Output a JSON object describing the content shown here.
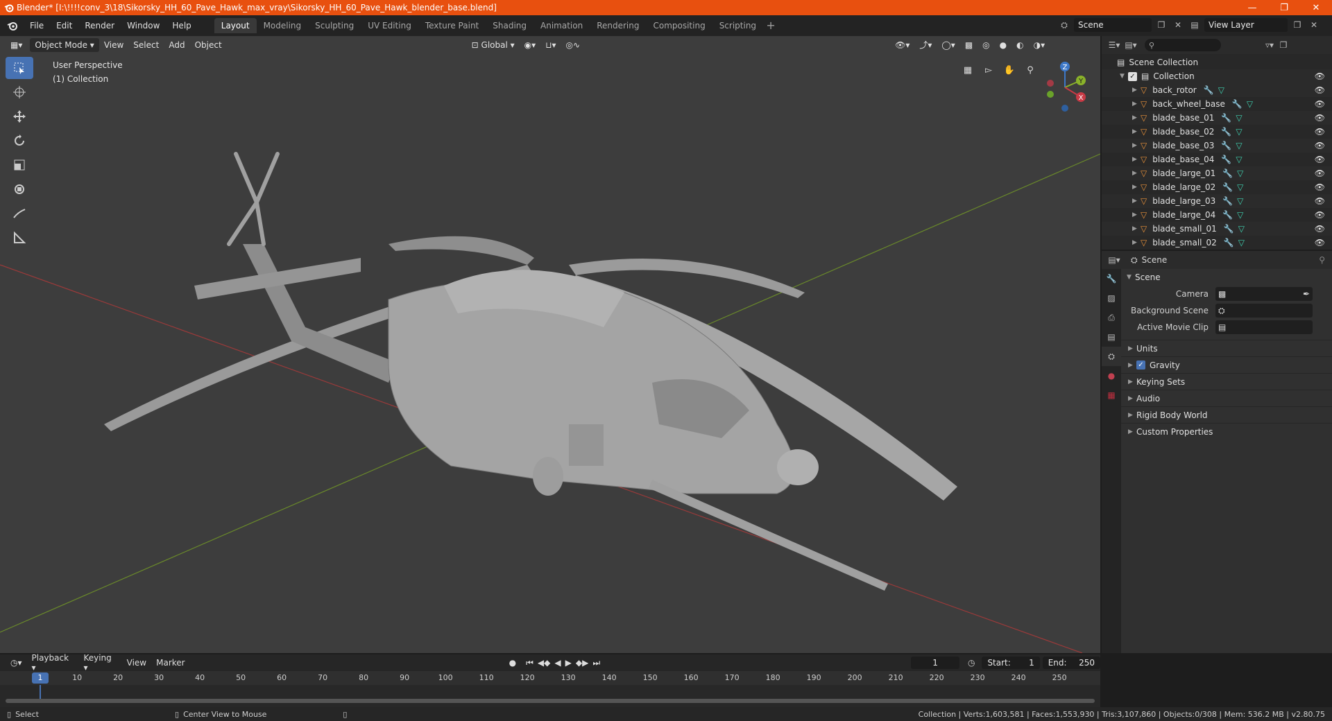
{
  "titlebar": {
    "title": "Blender* [I:\\!!!!conv_3\\18\\Sikorsky_HH_60_Pave_Hawk_max_vray\\Sikorsky_HH_60_Pave_Hawk_blender_base.blend]",
    "accent": "#e8500f"
  },
  "menu": {
    "file": "File",
    "edit": "Edit",
    "render": "Render",
    "window": "Window",
    "help": "Help"
  },
  "workspaces": [
    "Layout",
    "Modeling",
    "Sculpting",
    "UV Editing",
    "Texture Paint",
    "Shading",
    "Animation",
    "Rendering",
    "Compositing",
    "Scripting"
  ],
  "scene_block": {
    "scene": "Scene",
    "view_layer": "View Layer"
  },
  "viewport": {
    "mode": "Object Mode",
    "view": "View",
    "select": "Select",
    "add": "Add",
    "object": "Object",
    "orientation": "Global",
    "info_line1": "User Perspective",
    "info_line2": "(1) Collection",
    "gizmo": {
      "z": "Z",
      "y": "Y",
      "x": "X"
    }
  },
  "outliner": {
    "scene_collection": "Scene Collection",
    "collection": "Collection",
    "items": [
      "back_rotor",
      "back_wheel_base",
      "blade_base_01",
      "blade_base_02",
      "blade_base_03",
      "blade_base_04",
      "blade_large_01",
      "blade_large_02",
      "blade_large_03",
      "blade_large_04",
      "blade_small_01",
      "blade_small_02"
    ]
  },
  "properties": {
    "header": "Scene",
    "panel": "Scene",
    "camera_label": "Camera",
    "background_label": "Background Scene",
    "clip_label": "Active Movie Clip",
    "units": "Units",
    "gravity": "Gravity",
    "keying_sets": "Keying Sets",
    "audio": "Audio",
    "rigid_body": "Rigid Body World",
    "custom_props": "Custom Properties"
  },
  "timeline": {
    "playback": "Playback",
    "keying": "Keying",
    "view": "View",
    "marker": "Marker",
    "current_frame": "1",
    "start_label": "Start:",
    "start": "1",
    "end_label": "End:",
    "end": "250",
    "ticks": [
      "10",
      "20",
      "30",
      "40",
      "50",
      "60",
      "70",
      "80",
      "90",
      "100",
      "110",
      "120",
      "130",
      "140",
      "150",
      "160",
      "170",
      "180",
      "190",
      "200",
      "210",
      "220",
      "230",
      "240",
      "250"
    ],
    "current_marker": "1"
  },
  "statusbar": {
    "select": "Select",
    "center": "Center View to Mouse",
    "stats": "Collection | Verts:1,603,581 | Faces:1,553,930 | Tris:3,107,860 | Objects:0/308 | Mem: 536.2 MB | v2.80.75"
  }
}
